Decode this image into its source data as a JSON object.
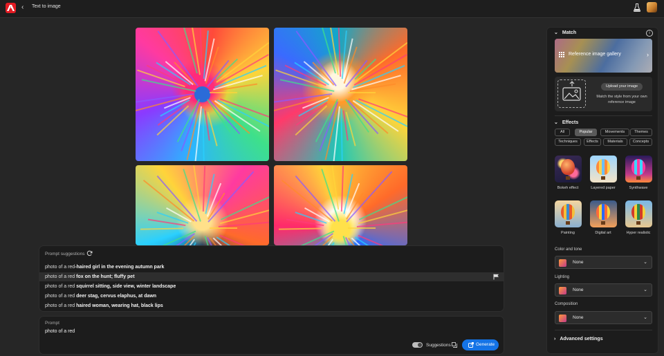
{
  "header": {
    "title": "Text to image"
  },
  "suggestions": {
    "title": "Prompt suggestions",
    "items": [
      {
        "prefix": "photo of a red",
        "rest": "-haired girl in the evening autumn park"
      },
      {
        "prefix": "photo of a red ",
        "rest": "fox on the hunt; fluffy pet"
      },
      {
        "prefix": "photo of a red ",
        "rest": "squirrel sitting, side view, winter landscape"
      },
      {
        "prefix": "photo of a red ",
        "rest": "deer stag, cervus elaphus, at dawn"
      },
      {
        "prefix": "photo of a red ",
        "rest": "haired woman, wearing hat, black lips"
      }
    ]
  },
  "prompt": {
    "label": "Prompt",
    "value": "photo of a red",
    "suggestions_label": "Suggestions",
    "suggestions_enabled": true,
    "generate_label": "Generate"
  },
  "panel": {
    "match": {
      "title": "Match",
      "gallery_label": "Reference image gallery",
      "upload_button": "Upload your image",
      "upload_desc": "Match the style from your own reference image"
    },
    "effects": {
      "title": "Effects",
      "tabs": [
        "All",
        "Popular",
        "Movements",
        "Themes",
        "Techniques",
        "Effects",
        "Materials",
        "Concepts"
      ],
      "active_tab": "Popular",
      "items": [
        "Bokeh effect",
        "Layered paper",
        "Synthwave",
        "Painting",
        "Digital art",
        "Hyper realistic"
      ]
    },
    "color_tone": {
      "label": "Color and tone",
      "value": "None"
    },
    "lighting": {
      "label": "Lighting",
      "value": "None"
    },
    "composition": {
      "label": "Composition",
      "value": "None"
    },
    "advanced": {
      "label": "Advanced settings"
    }
  },
  "colors": {
    "accent": "#1473e6",
    "brand": "#e31b23"
  }
}
